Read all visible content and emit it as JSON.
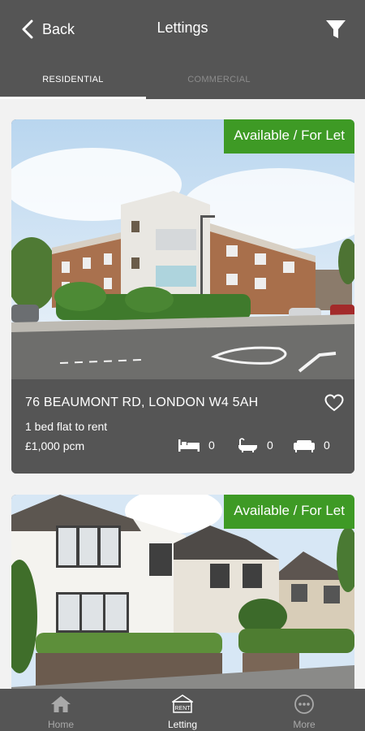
{
  "header": {
    "back_label": "Back",
    "title": "Lettings"
  },
  "tabs": [
    {
      "label": "RESIDENTIAL",
      "active": true
    },
    {
      "label": "COMMERCIAL",
      "active": false
    }
  ],
  "listings": [
    {
      "badge": "Available / For Let",
      "address": "76 BEAUMONT RD, LONDON W4 5AH",
      "description": "1 bed flat to rent",
      "price": "£1,000 pcm",
      "bedrooms": "0",
      "bathrooms": "0",
      "receptions": "0"
    },
    {
      "badge": "Available / For Let"
    }
  ],
  "bottom_nav": {
    "home_label": "Home",
    "letting_label": "Letting",
    "letting_icon_text": "RENT",
    "more_label": "More"
  },
  "colors": {
    "bar": "#555555",
    "badge_green": "#3e9a25",
    "background": "#f2f2f2"
  }
}
